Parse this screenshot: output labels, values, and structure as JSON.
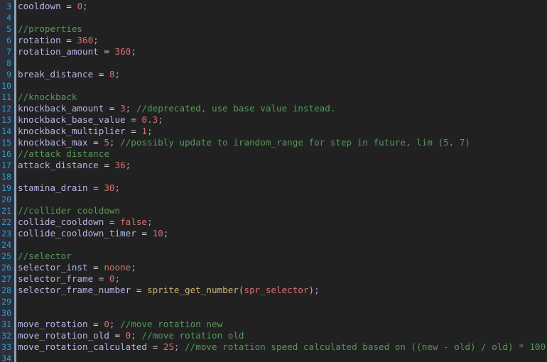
{
  "editor": {
    "background": "#212121",
    "gutter_background": "#2a2f3a",
    "gutter_bar_color": "#8ba3bd",
    "line_number_color": "#2f9ed4",
    "first_visible_line": 3,
    "last_visible_line": 34,
    "language": "GameMaker Language"
  },
  "palette": {
    "variable": "#b6b6e6",
    "number": "#d66f6f",
    "constant": "#d66f6f",
    "comment": "#56985a",
    "operator": "#cfcfcf",
    "punctuation": "#a89ed6",
    "function": "#d3b273",
    "paren": "#d3b273"
  },
  "lines": [
    {
      "number": "3",
      "tokens": [
        {
          "text": "cooldown",
          "type": "t-var"
        },
        {
          "text": " ",
          "type": "t-op"
        },
        {
          "text": "=",
          "type": "t-op"
        },
        {
          "text": " ",
          "type": "t-op"
        },
        {
          "text": "0",
          "type": "t-num"
        },
        {
          "text": ";",
          "type": "t-punc"
        }
      ]
    },
    {
      "number": "4",
      "tokens": []
    },
    {
      "number": "5",
      "tokens": [
        {
          "text": "//properties",
          "type": "t-com"
        }
      ]
    },
    {
      "number": "6",
      "tokens": [
        {
          "text": "rotation",
          "type": "t-var"
        },
        {
          "text": " = ",
          "type": "t-op"
        },
        {
          "text": "360",
          "type": "t-num"
        },
        {
          "text": ";",
          "type": "t-punc"
        }
      ]
    },
    {
      "number": "7",
      "tokens": [
        {
          "text": "rotation_amount",
          "type": "t-var"
        },
        {
          "text": " = ",
          "type": "t-op"
        },
        {
          "text": "360",
          "type": "t-num"
        },
        {
          "text": ";",
          "type": "t-punc"
        }
      ]
    },
    {
      "number": "8",
      "tokens": []
    },
    {
      "number": "9",
      "tokens": [
        {
          "text": "break_distance",
          "type": "t-var"
        },
        {
          "text": " = ",
          "type": "t-op"
        },
        {
          "text": "8",
          "type": "t-num"
        },
        {
          "text": ";",
          "type": "t-punc"
        }
      ]
    },
    {
      "number": "10",
      "tokens": []
    },
    {
      "number": "11",
      "tokens": [
        {
          "text": "//knockback",
          "type": "t-com"
        }
      ]
    },
    {
      "number": "12",
      "tokens": [
        {
          "text": "knockback_amount",
          "type": "t-var"
        },
        {
          "text": " = ",
          "type": "t-op"
        },
        {
          "text": "3",
          "type": "t-num"
        },
        {
          "text": ";",
          "type": "t-punc"
        },
        {
          "text": " ",
          "type": "t-op"
        },
        {
          "text": "//deprecated, use base value instead.",
          "type": "t-com"
        }
      ]
    },
    {
      "number": "13",
      "tokens": [
        {
          "text": "knockback_base_value",
          "type": "t-var"
        },
        {
          "text": " = ",
          "type": "t-op"
        },
        {
          "text": "0.3",
          "type": "t-num"
        },
        {
          "text": ";",
          "type": "t-punc"
        }
      ]
    },
    {
      "number": "14",
      "tokens": [
        {
          "text": "knockback_multiplier",
          "type": "t-var"
        },
        {
          "text": " = ",
          "type": "t-op"
        },
        {
          "text": "1",
          "type": "t-num"
        },
        {
          "text": ";",
          "type": "t-punc"
        }
      ]
    },
    {
      "number": "15",
      "tokens": [
        {
          "text": "knockback_max",
          "type": "t-var"
        },
        {
          "text": " = ",
          "type": "t-op"
        },
        {
          "text": "5",
          "type": "t-num"
        },
        {
          "text": ";",
          "type": "t-punc"
        },
        {
          "text": " ",
          "type": "t-op"
        },
        {
          "text": "//possibly update to irandom_range for step in future, lim (5, 7)",
          "type": "t-com"
        }
      ]
    },
    {
      "number": "16",
      "tokens": [
        {
          "text": "//attack distance",
          "type": "t-com"
        }
      ]
    },
    {
      "number": "17",
      "tokens": [
        {
          "text": "attack_distance",
          "type": "t-var"
        },
        {
          "text": " = ",
          "type": "t-op"
        },
        {
          "text": "36",
          "type": "t-num"
        },
        {
          "text": ";",
          "type": "t-punc"
        }
      ]
    },
    {
      "number": "18",
      "tokens": []
    },
    {
      "number": "19",
      "tokens": [
        {
          "text": "stamina_drain",
          "type": "t-var"
        },
        {
          "text": " = ",
          "type": "t-op"
        },
        {
          "text": "30",
          "type": "t-num"
        },
        {
          "text": ";",
          "type": "t-punc"
        }
      ]
    },
    {
      "number": "20",
      "tokens": []
    },
    {
      "number": "21",
      "tokens": [
        {
          "text": "//collider cooldown",
          "type": "t-com"
        }
      ]
    },
    {
      "number": "22",
      "tokens": [
        {
          "text": "collide_cooldown",
          "type": "t-var"
        },
        {
          "text": " = ",
          "type": "t-op"
        },
        {
          "text": "false",
          "type": "t-const"
        },
        {
          "text": ";",
          "type": "t-punc"
        }
      ]
    },
    {
      "number": "23",
      "tokens": [
        {
          "text": "collide_cooldown_timer",
          "type": "t-var"
        },
        {
          "text": " = ",
          "type": "t-op"
        },
        {
          "text": "10",
          "type": "t-num"
        },
        {
          "text": ";",
          "type": "t-punc"
        }
      ]
    },
    {
      "number": "24",
      "tokens": []
    },
    {
      "number": "25",
      "tokens": [
        {
          "text": "//selector",
          "type": "t-com"
        }
      ]
    },
    {
      "number": "26",
      "tokens": [
        {
          "text": "selector_inst",
          "type": "t-var"
        },
        {
          "text": " = ",
          "type": "t-op"
        },
        {
          "text": "noone",
          "type": "t-const"
        },
        {
          "text": ";",
          "type": "t-punc"
        }
      ]
    },
    {
      "number": "27",
      "tokens": [
        {
          "text": "selector_frame",
          "type": "t-var"
        },
        {
          "text": " = ",
          "type": "t-op"
        },
        {
          "text": "0",
          "type": "t-num"
        },
        {
          "text": ";",
          "type": "t-punc"
        }
      ]
    },
    {
      "number": "28",
      "tokens": [
        {
          "text": "selector_frame_number",
          "type": "t-var"
        },
        {
          "text": " = ",
          "type": "t-op"
        },
        {
          "text": "sprite_get_number",
          "type": "t-fn"
        },
        {
          "text": "(",
          "type": "t-paren"
        },
        {
          "text": "spr_selector",
          "type": "t-const"
        },
        {
          "text": ")",
          "type": "t-paren"
        },
        {
          "text": ";",
          "type": "t-punc"
        }
      ]
    },
    {
      "number": "29",
      "tokens": []
    },
    {
      "number": "30",
      "tokens": []
    },
    {
      "number": "31",
      "tokens": [
        {
          "text": "move_rotation",
          "type": "t-var"
        },
        {
          "text": " = ",
          "type": "t-op"
        },
        {
          "text": "0",
          "type": "t-num"
        },
        {
          "text": ";",
          "type": "t-punc"
        },
        {
          "text": " ",
          "type": "t-op"
        },
        {
          "text": "//move rotation new",
          "type": "t-com"
        }
      ]
    },
    {
      "number": "32",
      "tokens": [
        {
          "text": "move_rotation_old",
          "type": "t-var"
        },
        {
          "text": " = ",
          "type": "t-op"
        },
        {
          "text": "0",
          "type": "t-num"
        },
        {
          "text": ";",
          "type": "t-punc"
        },
        {
          "text": " ",
          "type": "t-op"
        },
        {
          "text": "//move rotation old",
          "type": "t-com"
        }
      ]
    },
    {
      "number": "33",
      "tokens": [
        {
          "text": "move_rotation_calculated",
          "type": "t-var"
        },
        {
          "text": " = ",
          "type": "t-op"
        },
        {
          "text": "25",
          "type": "t-num"
        },
        {
          "text": ";",
          "type": "t-punc"
        },
        {
          "text": " ",
          "type": "t-op"
        },
        {
          "text": "//move rotation speed calculated based on ((new - old) / old) * 100",
          "type": "t-com"
        }
      ]
    },
    {
      "number": "34",
      "tokens": []
    }
  ]
}
